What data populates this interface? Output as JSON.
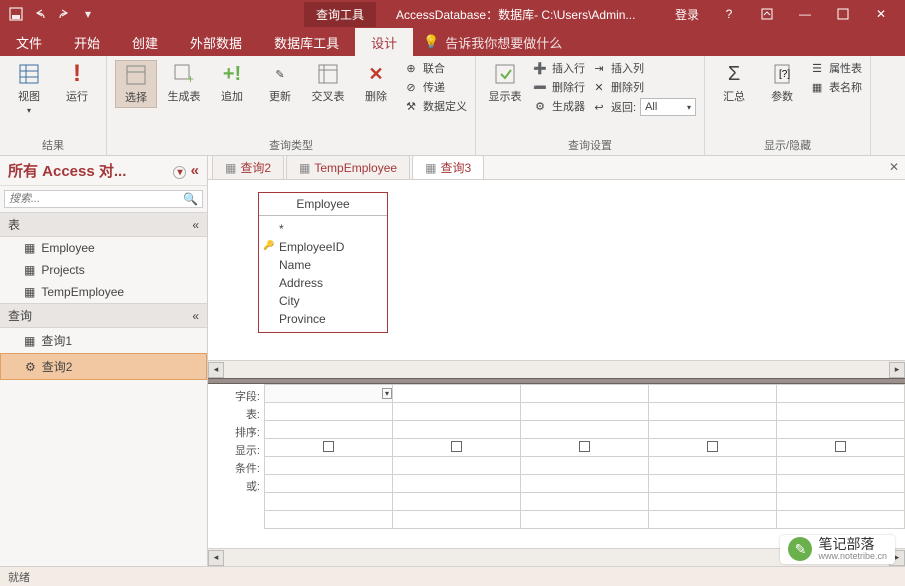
{
  "titlebar": {
    "context_tool": "查询工具",
    "title": "AccessDatabase：数据库- C:\\Users\\Admin...",
    "login": "登录"
  },
  "tabs": {
    "file": "文件",
    "home": "开始",
    "create": "创建",
    "external": "外部数据",
    "dbtools": "数据库工具",
    "design": "设计",
    "tellme": "告诉我你想要做什么"
  },
  "ribbon": {
    "view": "视图",
    "run": "运行",
    "select": "选择",
    "maketable": "生成表",
    "append": "追加",
    "update": "更新",
    "crosstab": "交叉表",
    "delete": "删除",
    "union": "联合",
    "passthrough": "传递",
    "datadef": "数据定义",
    "showtable": "显示表",
    "insertrow": "插入行",
    "deleterow": "删除行",
    "builder": "生成器",
    "insertcol": "插入列",
    "deletecol": "删除列",
    "return": "返回:",
    "return_val": "All",
    "totals": "汇总",
    "params": "参数",
    "propsheet": "属性表",
    "tablename": "表名称",
    "g_results": "结果",
    "g_querytype": "查询类型",
    "g_querysetup": "查询设置",
    "g_showhide": "显示/隐藏"
  },
  "nav": {
    "title": "所有 Access 对...",
    "search_ph": "搜索...",
    "g_tables": "表",
    "g_queries": "查询",
    "tables": [
      "Employee",
      "Projects",
      "TempEmployee"
    ],
    "queries": [
      "查询1",
      "查询2"
    ]
  },
  "doctabs": [
    "查询2",
    "TempEmployee",
    "查询3"
  ],
  "fieldlist": {
    "title": "Employee",
    "fields": [
      "*",
      "EmployeeID",
      "Name",
      "Address",
      "City",
      "Province"
    ],
    "pk_index": 1
  },
  "gridlabels": [
    "字段:",
    "表:",
    "排序:",
    "显示:",
    "条件:",
    "或:"
  ],
  "status": "就绪",
  "watermark": {
    "text": "笔记部落",
    "url": "www.notetribe.cn"
  }
}
